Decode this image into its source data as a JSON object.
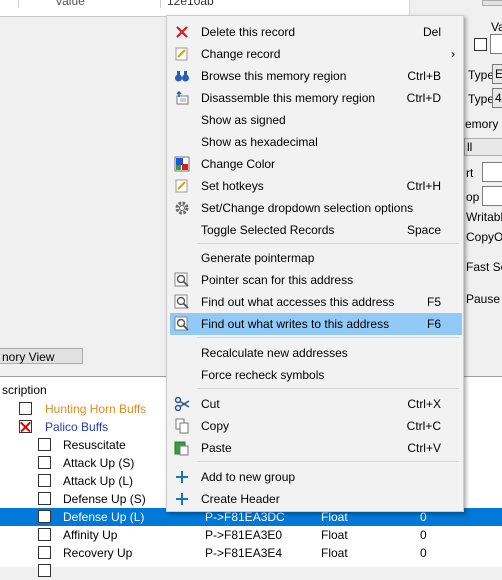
{
  "top_header": {
    "value_col": "Value",
    "value_text": "12e10ab"
  },
  "right_panel": {
    "va_label": "Va",
    "type1_label": "Type",
    "type1_value": "Ex",
    "type2_label": "Type",
    "type2_value": "4",
    "memory_label": "emory",
    "ll_label": "ll",
    "rt_label": "rt",
    "op_label": "op",
    "writable_label": "Writabl",
    "copyo_label": "CopyO",
    "fastscan_label": "Fast Sca",
    "pause_label": "Pause t"
  },
  "memory_view_button": "nory View",
  "table": {
    "header_description": "scription",
    "rows": [
      {
        "name": "Hunting Horn Buffs",
        "color": "#e08a1e",
        "checkbox": "empty",
        "indent": 1
      },
      {
        "name": "Palico Buffs",
        "color": "#1f3fbf",
        "checkbox": "x",
        "indent": 1
      },
      {
        "name": "Resuscitate",
        "color": "#000000",
        "checkbox": "empty",
        "indent": 2
      },
      {
        "name": "Attack Up (S)",
        "color": "#000000",
        "checkbox": "empty",
        "indent": 2
      },
      {
        "name": "Attack Up (L)",
        "color": "#000000",
        "checkbox": "empty",
        "indent": 2
      },
      {
        "name": "Defense Up (S)",
        "color": "#000000",
        "checkbox": "empty",
        "indent": 2
      },
      {
        "name": "Defense Up (L)",
        "color": "#ffffff",
        "checkbox": "empty",
        "indent": 2,
        "selected": true,
        "address": "P->F81EA3DC",
        "type": "Float",
        "value": "0"
      },
      {
        "name": "Affinity Up",
        "color": "#000000",
        "checkbox": "empty",
        "indent": 2,
        "address": "P->F81EA3E0",
        "type": "Float",
        "value": "0"
      },
      {
        "name": "Recovery Up",
        "color": "#000000",
        "checkbox": "empty",
        "indent": 2,
        "address": "P->F81EA3E4",
        "type": "Float",
        "value": "0"
      }
    ]
  },
  "context_menu": {
    "items": [
      {
        "label": "Delete this record",
        "shortcut": "Del",
        "icon": "delete-x-icon"
      },
      {
        "label": "Change record",
        "shortcut": "",
        "icon": "edit-note-icon",
        "submenu": "›"
      },
      {
        "label": "Browse this memory region",
        "shortcut": "Ctrl+B",
        "icon": "binoculars-icon"
      },
      {
        "label": "Disassemble this memory region",
        "shortcut": "Ctrl+D",
        "icon": "disassemble-icon"
      },
      {
        "label": "Show as signed",
        "shortcut": "",
        "icon": ""
      },
      {
        "label": "Show as hexadecimal",
        "shortcut": "",
        "icon": ""
      },
      {
        "label": "Change Color",
        "shortcut": "",
        "icon": "color-palette-icon"
      },
      {
        "label": "Set hotkeys",
        "shortcut": "Ctrl+H",
        "icon": "hotkey-note-icon"
      },
      {
        "label": "Set/Change dropdown selection options",
        "shortcut": "",
        "icon": "gear-icon"
      },
      {
        "label": "Toggle Selected Records",
        "shortcut": "Space",
        "icon": ""
      },
      {
        "label": "Generate pointermap",
        "shortcut": "",
        "icon": ""
      },
      {
        "label": "Pointer scan for this address",
        "shortcut": "",
        "icon": "pointer-scan-icon"
      },
      {
        "label": "Find out what accesses this address",
        "shortcut": "F5",
        "icon": "find-access-icon"
      },
      {
        "label": "Find out what writes to this address",
        "shortcut": "F6",
        "icon": "find-write-icon"
      },
      {
        "label": "Recalculate new addresses",
        "shortcut": "",
        "icon": ""
      },
      {
        "label": "Force recheck symbols",
        "shortcut": "",
        "icon": ""
      },
      {
        "label": "Cut",
        "shortcut": "Ctrl+X",
        "icon": "scissors-icon"
      },
      {
        "label": "Copy",
        "shortcut": "Ctrl+C",
        "icon": "copy-icon"
      },
      {
        "label": "Paste",
        "shortcut": "Ctrl+V",
        "icon": "paste-icon"
      },
      {
        "label": "Add to new group",
        "shortcut": "",
        "icon": "plus-icon"
      },
      {
        "label": "Create Header",
        "shortcut": "",
        "icon": "plus-icon"
      }
    ]
  },
  "colors": {
    "selection": "#0078d7",
    "menu_highlight": "#91c9f7",
    "delete_red": "#d81e1e",
    "plus_blue": "#1a73c9"
  }
}
